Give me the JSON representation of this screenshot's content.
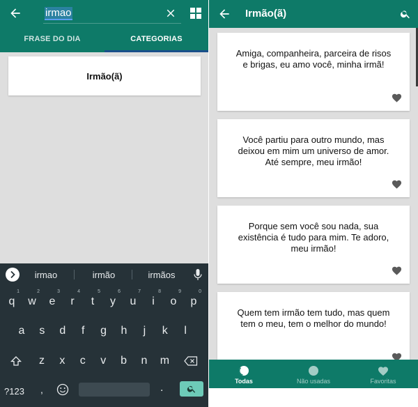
{
  "left": {
    "search": {
      "value": "irmao"
    },
    "tabs": [
      {
        "label": "FRASE DO DIA",
        "active": false
      },
      {
        "label": "CATEGORIAS",
        "active": true
      }
    ],
    "results": [
      {
        "label": "Irmão(ã)"
      }
    ],
    "keyboard": {
      "suggestions": [
        "irmao",
        "irmão",
        "irmãos"
      ],
      "row1": [
        {
          "k": "q",
          "s": "1"
        },
        {
          "k": "w",
          "s": "2"
        },
        {
          "k": "e",
          "s": "3"
        },
        {
          "k": "r",
          "s": "4"
        },
        {
          "k": "t",
          "s": "5"
        },
        {
          "k": "y",
          "s": "6"
        },
        {
          "k": "u",
          "s": "7"
        },
        {
          "k": "i",
          "s": "8"
        },
        {
          "k": "o",
          "s": "9"
        },
        {
          "k": "p",
          "s": "0"
        }
      ],
      "row2": [
        "a",
        "s",
        "d",
        "f",
        "g",
        "h",
        "j",
        "k",
        "l"
      ],
      "row3": [
        "z",
        "x",
        "c",
        "v",
        "b",
        "n",
        "m"
      ],
      "symbols_key": "?123",
      "comma_key": ",",
      "period_key": "."
    }
  },
  "right": {
    "title": "Irmão(ã)",
    "quotes": [
      {
        "text": "Amiga, companheira, parceira de risos e brigas, eu amo você, minha irmã!"
      },
      {
        "text": "Você partiu para outro mundo, mas deixou em mim um universo de amor. Até sempre, meu irmão!"
      },
      {
        "text": "Porque sem você sou nada, sua existência é tudo para mim. Te adoro, meu irmão!"
      },
      {
        "text": "Quem tem irmão tem tudo, mas quem tem o meu, tem o melhor do mundo!"
      }
    ],
    "bottom_nav": [
      {
        "label": "Todas",
        "icon": "circle-outline-icon",
        "active": true
      },
      {
        "label": "Não usadas",
        "icon": "circle-icon",
        "active": false
      },
      {
        "label": "Favoritas",
        "icon": "heart-icon",
        "active": false
      }
    ]
  },
  "colors": {
    "primary": "#0e7a68",
    "accent": "#6dcbb8",
    "keyboard_bg": "#263238",
    "background": "#dedede"
  }
}
